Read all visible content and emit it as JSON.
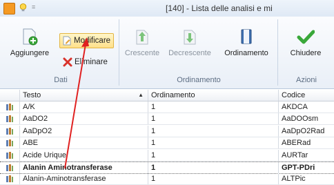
{
  "window": {
    "title": "[140] - Lista delle analisi e mi"
  },
  "quick_access": {
    "more_glyph": "="
  },
  "ribbon": {
    "groups": [
      {
        "label": "Dati"
      },
      {
        "label": "Ordinamento"
      },
      {
        "label": "Azioni"
      }
    ],
    "buttons": {
      "aggiungere": "Aggiungere",
      "modificare": "Modificare",
      "eliminare": "Eliminare",
      "crescente": "Crescente",
      "decrescente": "Decrescente",
      "ordinamento": "Ordinamento",
      "chiudere": "Chiudere"
    }
  },
  "grid": {
    "columns": [
      "Testo",
      "Ordinamento",
      "Codice"
    ],
    "sort_indicator": "▲",
    "rows": [
      {
        "testo": "A/K",
        "ordinamento": "1",
        "codice": "AKDCA"
      },
      {
        "testo": "AaDO2",
        "ordinamento": "1",
        "codice": "AaDOOsm"
      },
      {
        "testo": "AaDpO2",
        "ordinamento": "1",
        "codice": "AaDpO2Rad"
      },
      {
        "testo": "ABE",
        "ordinamento": "1",
        "codice": "ABERad"
      },
      {
        "testo": "Acide Urique",
        "ordinamento": "1",
        "codice": "AURTar"
      },
      {
        "testo": "Alanin Aminotransferase",
        "ordinamento": "1",
        "codice": "GPT-PDri"
      },
      {
        "testo": "Alanin-Aminotransferase",
        "ordinamento": "1",
        "codice": "ALTPic"
      }
    ],
    "selected_row": 5
  },
  "colors": {
    "accent": "#f59a23",
    "annotation": "#e02020"
  }
}
